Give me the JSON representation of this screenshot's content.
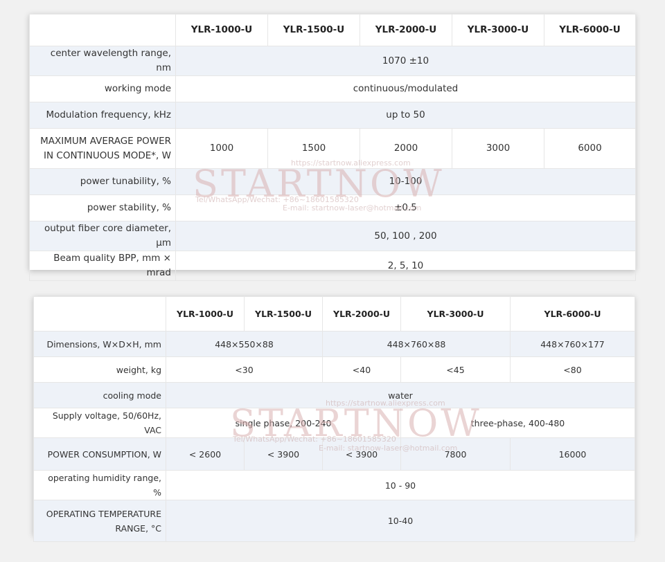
{
  "watermark": {
    "logo": "STARTNOW",
    "url": "https://startnow.aliexpress.com",
    "contact": "Tel/WhatsApp/Wechat: +86~18601585320",
    "email": "E-mail: startnow-laser@hotmail.com"
  },
  "table1": {
    "headers": [
      "YLR-1000-U",
      "YLR-1500-U",
      "YLR-2000-U",
      "YLR-3000-U",
      "YLR-6000-U"
    ],
    "rows": {
      "wavelength": {
        "label": "center wavelength range, nm",
        "value": "1070 ±10"
      },
      "mode": {
        "label": "working mode",
        "value": "continuous/modulated"
      },
      "modulation": {
        "label": "Modulation frequency, kHz",
        "value": "up to 50"
      },
      "max_power": {
        "label_line1": "MAXIMUM AVERAGE POWER",
        "label_line2": "IN CONTINUOUS MODE*, W",
        "values": [
          "1000",
          "1500",
          "2000",
          "3000",
          "6000"
        ]
      },
      "tunability": {
        "label": "power tunability, %",
        "value": "10-100"
      },
      "stability": {
        "label": "power stability, %",
        "value": "±0.5"
      },
      "fiber": {
        "label": "output fiber core diameter, μm",
        "value": "50, 100 , 200"
      },
      "bpp": {
        "label": "Beam quality BPP, mm × mrad",
        "value": "2, 5, 10"
      }
    }
  },
  "table2": {
    "headers": [
      "YLR-1000-U",
      "YLR-1500-U",
      "YLR-2000-U",
      "YLR-3000-U",
      "YLR-6000-U"
    ],
    "rows": {
      "dimensions": {
        "label": "Dimensions, W×D×H, mm",
        "v1": "448×550×88",
        "v2": "448×760×88",
        "v3": "448×760×177"
      },
      "weight": {
        "label": "weight, kg",
        "v1": "<30",
        "v2": "<40",
        "v3": "<45",
        "v4": "<80"
      },
      "cooling": {
        "label": "cooling mode",
        "value": "water"
      },
      "voltage": {
        "label": "Supply voltage, 50/60Hz, VAC",
        "v1": "single phase, 200-240",
        "v2": "three-phase, 400-480"
      },
      "consumption": {
        "label": "POWER CONSUMPTION, W",
        "values": [
          "< 2600",
          "< 3900",
          "< 3900",
          "7800",
          "16000"
        ]
      },
      "humidity": {
        "label": "operating humidity range, %",
        "value": "10 - 90"
      },
      "temperature": {
        "label_line1": "OPERATING TEMPERATURE",
        "label_line2": "RANGE, °C",
        "value": "10-40"
      }
    }
  }
}
